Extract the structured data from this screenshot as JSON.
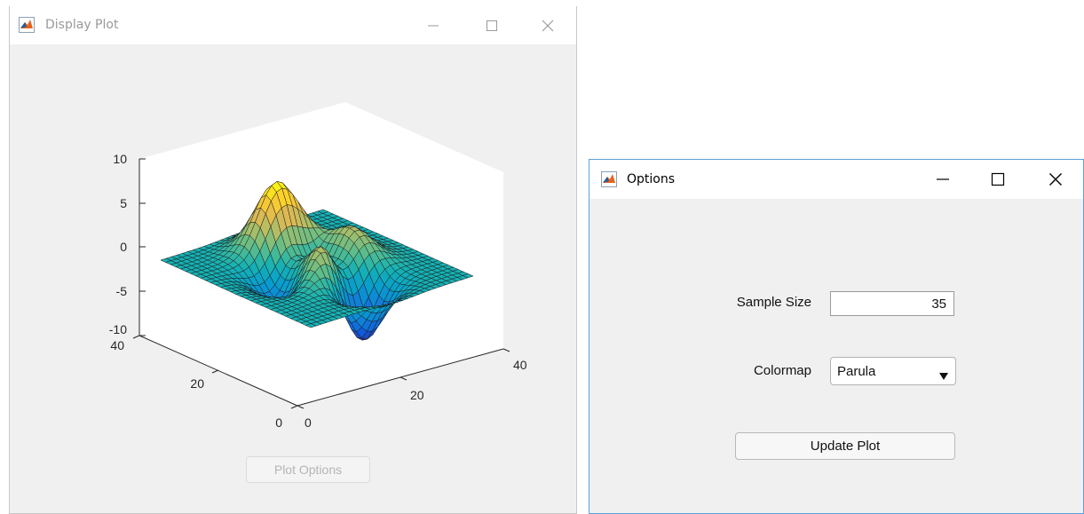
{
  "plot_window": {
    "title": "Display Plot",
    "plot_options_label": "Plot Options",
    "axes": {
      "z_ticks": [
        "10",
        "5",
        "0",
        "-5",
        "-10"
      ],
      "y_ticks": [
        "40",
        "20",
        "0"
      ],
      "x_ticks": [
        "0",
        "20",
        "40"
      ]
    }
  },
  "options_window": {
    "title": "Options",
    "sample_size_label": "Sample Size",
    "sample_size_value": "35",
    "colormap_label": "Colormap",
    "colormap_value": "Parula",
    "update_label": "Update Plot"
  },
  "chart_data": {
    "type": "surface",
    "function": "peaks",
    "zlim": [
      -10,
      10
    ],
    "xlim": [
      0,
      40
    ],
    "ylim": [
      0,
      40
    ],
    "colormap": "Parula",
    "grid": false
  },
  "colors": {
    "options_border": "#5aa0d8",
    "window_bg": "#f0f0f0"
  }
}
